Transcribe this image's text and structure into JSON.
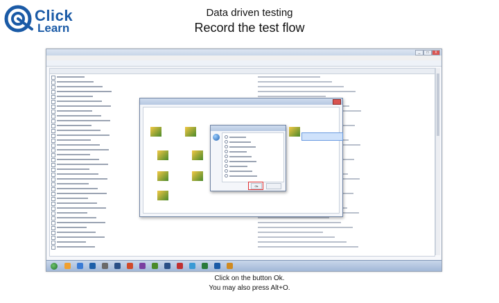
{
  "header": {
    "logo_line1": "Click",
    "logo_line2": "Learn",
    "title": "Data driven testing",
    "subtitle": "Record the test flow"
  },
  "colors": {
    "brand": "#1a5aa6",
    "highlight_ring": "#e03030"
  },
  "icons": [
    "click-learn-logo-icon",
    "globe-icon",
    "windows-start-icon",
    "taskbar-app-icon"
  ],
  "screenshot": {
    "window_controls": [
      "_",
      "□",
      "X"
    ],
    "dialog_ok_label": "Ok"
  },
  "caption": {
    "line1": "Click on the button Ok.",
    "line2": "You may also press Alt+O."
  }
}
